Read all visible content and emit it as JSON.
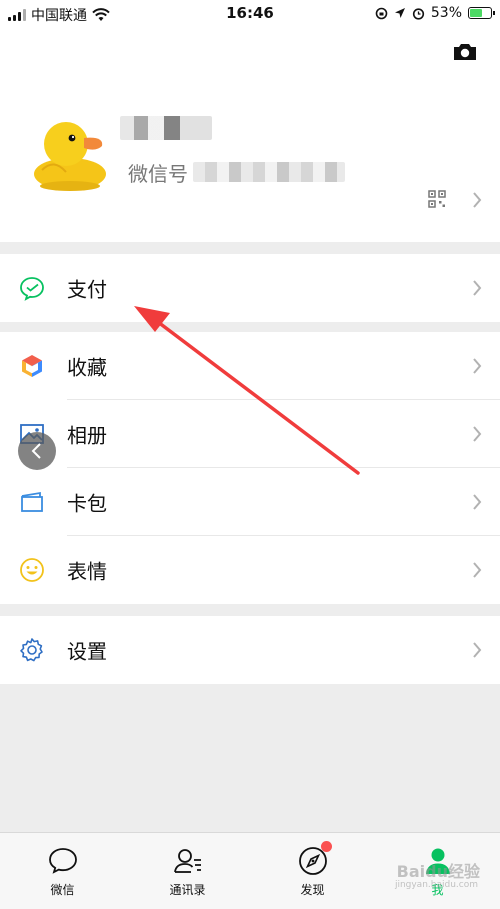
{
  "status_bar": {
    "carrier": "中国联通",
    "time": "16:46",
    "battery_percent": "53%",
    "battery_level": 0.53
  },
  "profile": {
    "wechat_id_label": "微信号"
  },
  "menu_groups": [
    [
      {
        "label": "支付",
        "icon": "wechat-pay-icon"
      }
    ],
    [
      {
        "label": "收藏",
        "icon": "favorites-cube-icon"
      },
      {
        "label": "相册",
        "icon": "album-photo-icon"
      },
      {
        "label": "卡包",
        "icon": "card-wallet-icon"
      },
      {
        "label": "表情",
        "icon": "sticker-smile-icon"
      }
    ],
    [
      {
        "label": "设置",
        "icon": "settings-gear-icon"
      }
    ]
  ],
  "tabs": [
    {
      "label": "微信",
      "icon": "chat-bubble-icon",
      "active": false
    },
    {
      "label": "通讯录",
      "icon": "contacts-icon",
      "active": false
    },
    {
      "label": "发现",
      "icon": "compass-icon",
      "active": false,
      "badge": true
    },
    {
      "label": "我",
      "icon": "person-icon",
      "active": true
    }
  ],
  "watermark": {
    "text": "Baidu经验",
    "sub": "jingyan.baidu.com"
  },
  "colors": {
    "accent_green": "#07c160",
    "arrow_red": "#f03c3c",
    "badge_red": "#fa5151",
    "background": "#ededed"
  }
}
